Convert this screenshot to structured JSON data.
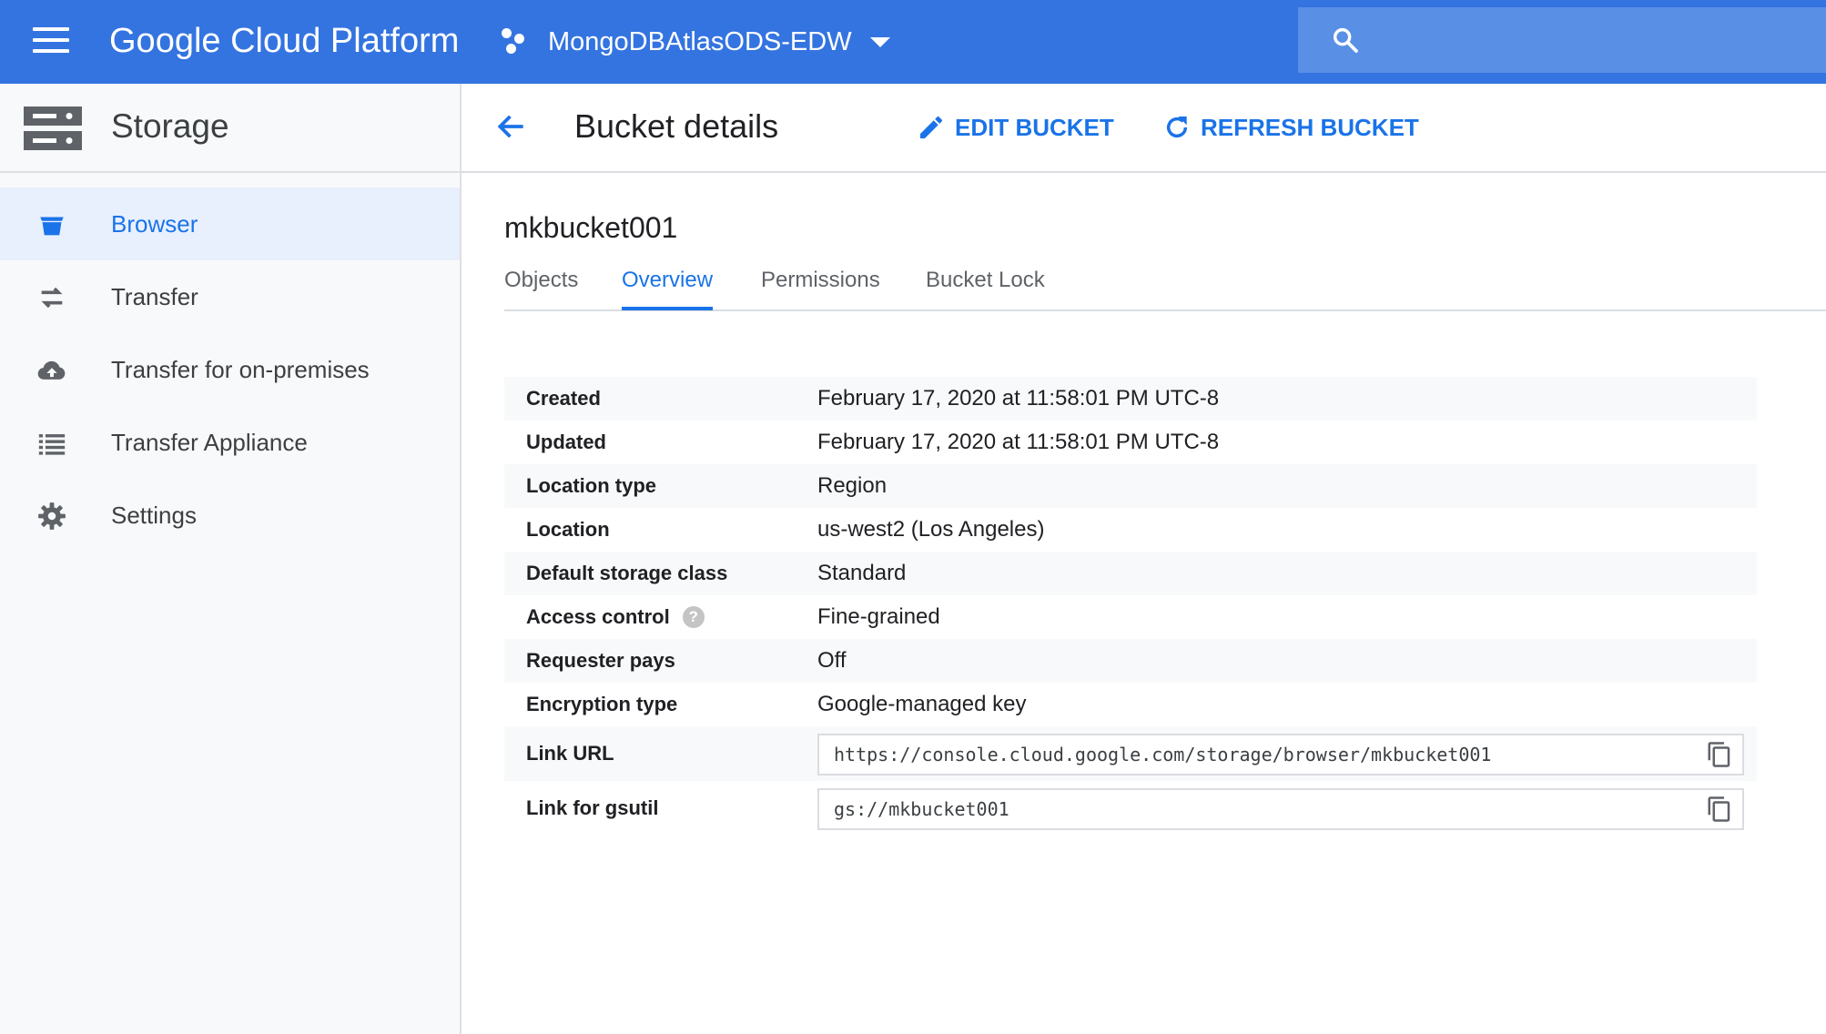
{
  "topbar": {
    "brand": "Google Cloud Platform",
    "project_name": "MongoDBAtlasODS-EDW",
    "icons": [
      "menu-icon",
      "project-icon",
      "chevron-down-icon",
      "search-icon"
    ],
    "color": "#3474e0"
  },
  "sidebar": {
    "title": "Storage",
    "items": [
      {
        "label": "Browser",
        "icon": "bucket-icon",
        "active": true
      },
      {
        "label": "Transfer",
        "icon": "transfer-arrows-icon",
        "active": false
      },
      {
        "label": "Transfer for on-premises",
        "icon": "cloud-upload-icon",
        "active": false
      },
      {
        "label": "Transfer Appliance",
        "icon": "list-icon",
        "active": false
      },
      {
        "label": "Settings",
        "icon": "gear-icon",
        "active": false
      }
    ]
  },
  "header": {
    "title": "Bucket details",
    "edit_label": "EDIT BUCKET",
    "refresh_label": "REFRESH BUCKET"
  },
  "bucket": {
    "name": "mkbucket001",
    "tabs": [
      {
        "label": "Objects",
        "active": false
      },
      {
        "label": "Overview",
        "active": true
      },
      {
        "label": "Permissions",
        "active": false
      },
      {
        "label": "Bucket Lock",
        "active": false
      }
    ],
    "details": [
      {
        "key": "Created",
        "value": "February 17, 2020 at 11:58:01 PM UTC-8"
      },
      {
        "key": "Updated",
        "value": "February 17, 2020 at 11:58:01 PM UTC-8"
      },
      {
        "key": "Location type",
        "value": "Region"
      },
      {
        "key": "Location",
        "value": "us-west2 (Los Angeles)"
      },
      {
        "key": "Default storage class",
        "value": "Standard"
      },
      {
        "key": "Access control",
        "value": "Fine-grained",
        "help": "?"
      },
      {
        "key": "Requester pays",
        "value": "Off"
      },
      {
        "key": "Encryption type",
        "value": "Google-managed key"
      }
    ],
    "links": [
      {
        "key": "Link URL",
        "value": "https://console.cloud.google.com/storage/browser/mkbucket001"
      },
      {
        "key": "Link for gsutil",
        "value": "gs://mkbucket001"
      }
    ]
  },
  "colors": {
    "accent": "#1a73e8",
    "sidebar_active": "#e8f0fe"
  }
}
